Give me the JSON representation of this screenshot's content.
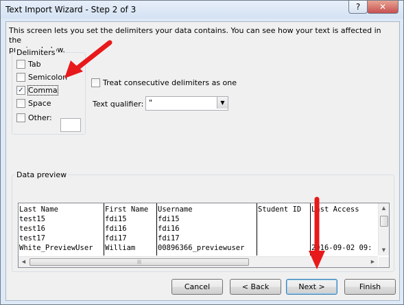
{
  "window": {
    "title": "Text Import Wizard - Step 2 of 3",
    "help_label": "?",
    "close_label": "✕"
  },
  "intro": {
    "line1": "This screen lets you set the delimiters your data contains.  You can see how your text is affected in the",
    "line2": "preview below."
  },
  "delimiters": {
    "legend": "Delimiters",
    "options": [
      {
        "label": "Tab",
        "checked": false
      },
      {
        "label": "Semicolon",
        "checked": false
      },
      {
        "label": "Comma",
        "checked": true
      },
      {
        "label": "Space",
        "checked": false
      },
      {
        "label": "Other:",
        "checked": false
      }
    ],
    "other_value": ""
  },
  "consecutive": {
    "label": "Treat consecutive delimiters as one",
    "checked": false
  },
  "qualifier": {
    "label": "Text qualifier:",
    "value": "\""
  },
  "preview": {
    "legend": "Data preview",
    "rows": [
      [
        "Last Name",
        "First Name",
        "Username",
        "Student ID",
        "Last Access"
      ],
      [
        "test15",
        "fdi15",
        "fdi15",
        "",
        ""
      ],
      [
        "test16",
        "fdi16",
        "fdi16",
        "",
        ""
      ],
      [
        "test17",
        "fdi17",
        "fdi17",
        "",
        ""
      ],
      [
        "White_PreviewUser",
        "William",
        "00896366_previewuser",
        "",
        "2016-09-02 09:"
      ]
    ],
    "hthumb_glyph": "|||"
  },
  "buttons": {
    "cancel": "Cancel",
    "back": "< Back",
    "next": "Next >",
    "finish": "Finish"
  },
  "colors": {
    "annotation_arrow": "#e8191b"
  }
}
